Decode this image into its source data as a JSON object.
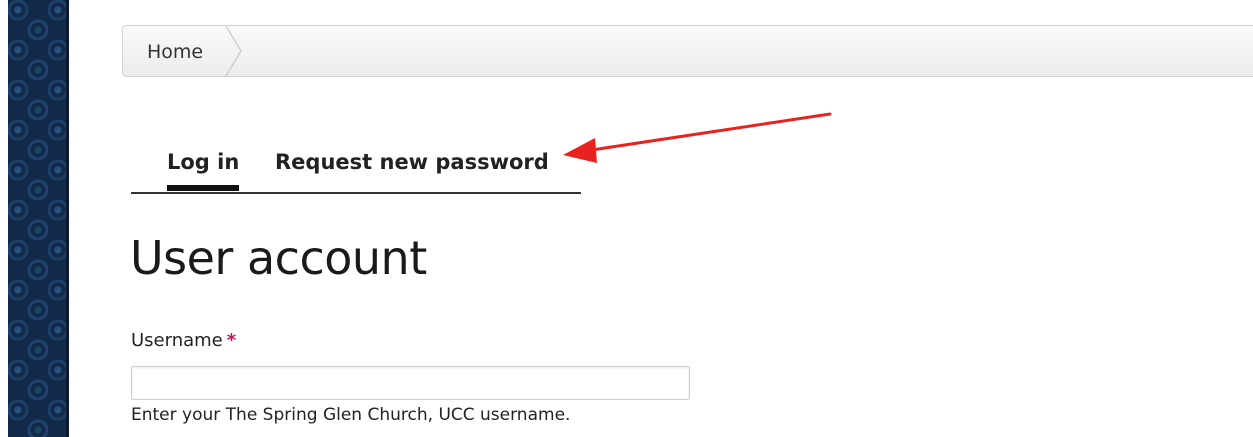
{
  "breadcrumb": {
    "home_label": "Home"
  },
  "tabs": [
    {
      "label": "Log in",
      "active": true
    },
    {
      "label": "Request new password",
      "active": false
    }
  ],
  "page": {
    "title": "User account"
  },
  "form": {
    "username": {
      "label": "Username",
      "required_mark": "*",
      "value": "",
      "description": "Enter your The Spring Glen Church, UCC username."
    }
  },
  "annotation": {
    "arrow_color": "#e8231f"
  },
  "colors": {
    "sidebar": "#13294a",
    "required": "#c2185b"
  }
}
